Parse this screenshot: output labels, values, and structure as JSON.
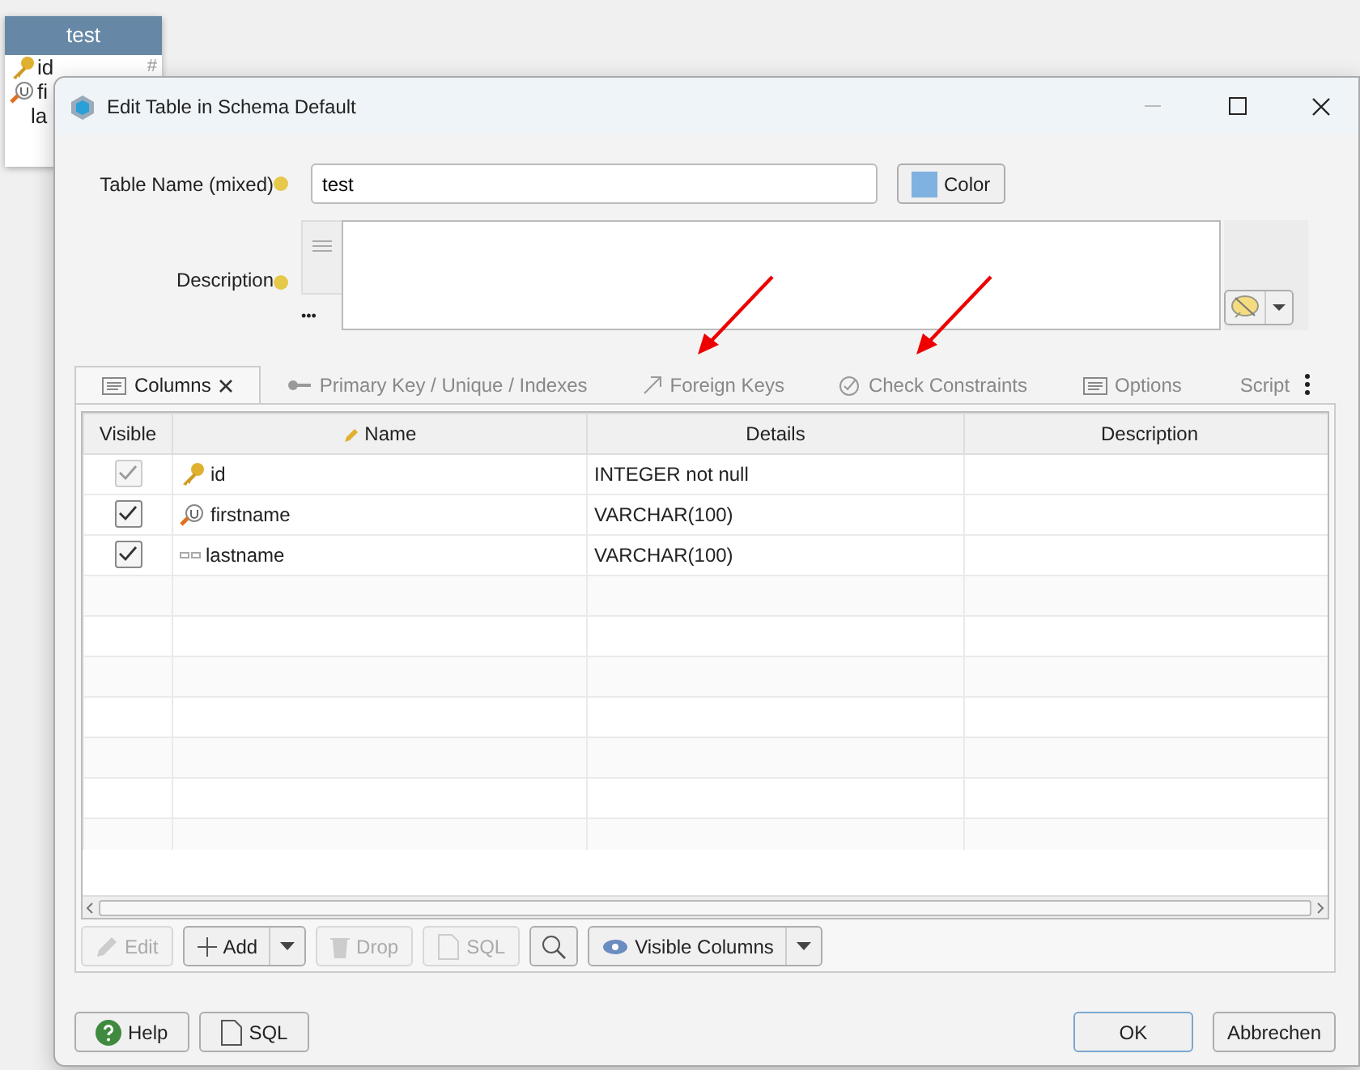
{
  "background_entity": {
    "title": "test",
    "rows": [
      {
        "name": "id",
        "kind": "primary",
        "type_mark": "#"
      },
      {
        "name": "fi",
        "kind": "unique"
      },
      {
        "name": "la",
        "kind": "plain"
      }
    ]
  },
  "window": {
    "title": "Edit Table in Schema Default"
  },
  "form": {
    "table_name_label": "Table Name (mixed)",
    "table_name": "test",
    "color_button": "Color",
    "color": "#7fb2e0",
    "description_label": "Description",
    "more": "•••"
  },
  "tabs": [
    {
      "label": "Columns",
      "selected": true,
      "closable": true,
      "kind": "columns",
      "annotated": false
    },
    {
      "label": "Primary Key / Unique / Indexes",
      "selected": false,
      "kind": "keys",
      "annotated": false
    },
    {
      "label": "Foreign Keys",
      "selected": false,
      "kind": "foreign_keys",
      "annotated": true
    },
    {
      "label": "Check Constraints",
      "selected": false,
      "kind": "checks",
      "annotated": true
    },
    {
      "label": "Options",
      "selected": false,
      "kind": "options",
      "annotated": false
    },
    {
      "label": "Script",
      "selected": false,
      "kind": "script",
      "annotated": false
    }
  ],
  "table": {
    "columns": [
      "Visible",
      "Name",
      "Details",
      "Description"
    ],
    "rows": [
      {
        "visible": true,
        "disabled": true,
        "kind": "primary",
        "name": "id",
        "details": "INTEGER not null"
      },
      {
        "visible": true,
        "disabled": false,
        "kind": "unique",
        "name": "firstname",
        "details": "VARCHAR(100)"
      },
      {
        "visible": true,
        "disabled": false,
        "kind": "plain",
        "name": "lastname",
        "details": "VARCHAR(100)"
      }
    ]
  },
  "toolbar": [
    {
      "kind": "edit",
      "label": "Edit",
      "disabled": true
    },
    {
      "kind": "add",
      "label": "Add",
      "disabled": false,
      "split": true
    },
    {
      "kind": "drop",
      "label": "Drop",
      "disabled": true
    },
    {
      "kind": "sql",
      "label": "SQL",
      "disabled": true
    },
    {
      "kind": "search",
      "disabled": false
    },
    {
      "kind": "eye",
      "label": "Visible Columns",
      "disabled": false,
      "split": true
    }
  ],
  "footer_left": [
    {
      "kind": "help",
      "label": "Help"
    },
    {
      "kind": "sql",
      "label": "SQL"
    }
  ],
  "footer_right": [
    {
      "label": "OK",
      "default": true
    },
    {
      "label": "Abbrechen",
      "default": false
    }
  ]
}
